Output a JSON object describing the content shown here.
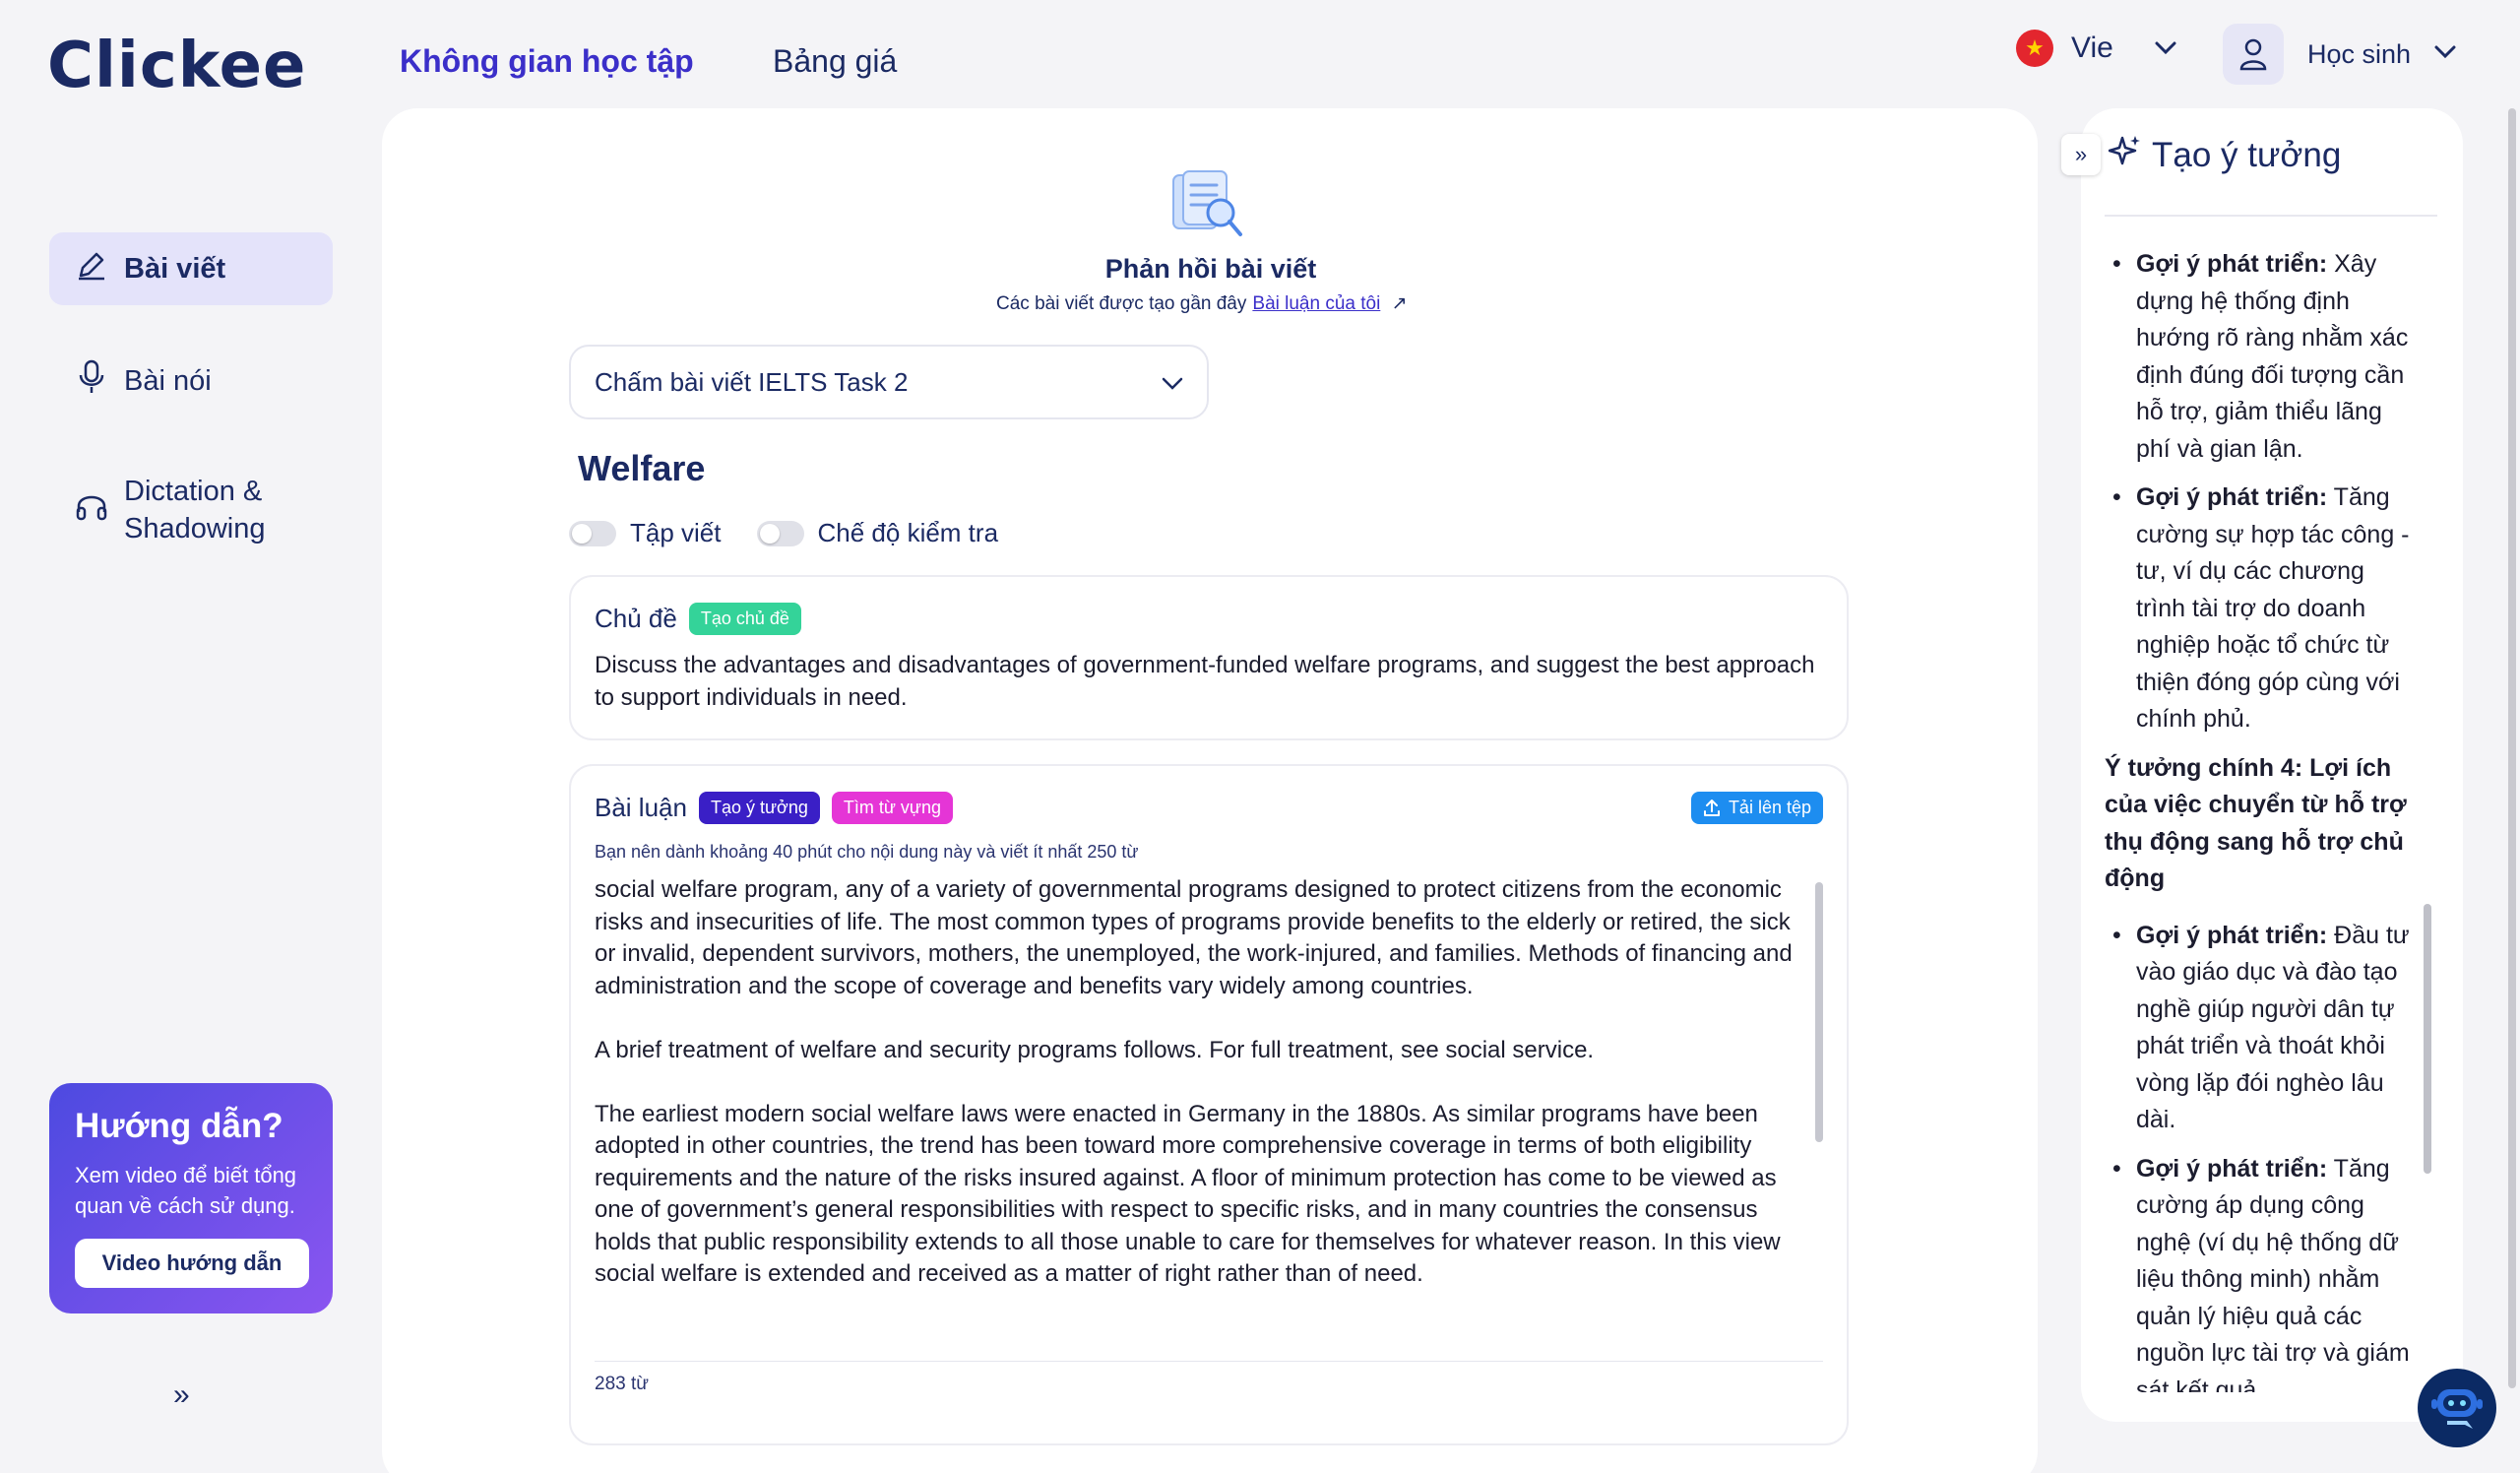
{
  "header": {
    "logo": "Clickee",
    "nav": {
      "learning_space": "Không gian học tập",
      "pricing": "Bảng giá"
    },
    "language": "Vie",
    "user_role": "Học sinh"
  },
  "sidebar": {
    "items": [
      {
        "label": "Bài viết",
        "icon": "pencil-icon"
      },
      {
        "label": "Bài nói",
        "icon": "microphone-icon"
      },
      {
        "label": "Dictation & Shadowing",
        "icon": "headphones-icon"
      }
    ],
    "guide": {
      "title": "Hướng dẫn?",
      "text": "Xem video để biết tổng quan về cách sử dụng.",
      "button": "Video hướng dẫn"
    },
    "expand": "»"
  },
  "main": {
    "feedback_title": "Phản hồi bài viết",
    "feedback_sub": "Các bài viết được tạo gần đây",
    "feedback_link": "Bài luận của tôi",
    "task_select": "Chấm bài viết IELTS Task 2",
    "topic_title": "Welfare",
    "toggle_practice": "Tập viết",
    "toggle_test": "Chế độ kiểm tra",
    "topic": {
      "label": "Chủ đề",
      "badge": "Tạo chủ đề",
      "text": "Discuss the advantages and disadvantages of government-funded welfare programs, and suggest the best approach to support individuals in need."
    },
    "essay": {
      "label": "Bài luận",
      "badge_ideas": "Tạo ý tưởng",
      "badge_vocab": "Tìm từ vựng",
      "upload": "Tải lên tệp",
      "hint": "Bạn nên dành khoảng 40 phút cho nội dung này và viết ít nhất 250 từ",
      "paragraphs": [
        "social welfare program, any of a variety of governmental programs designed to protect citizens from the economic risks and insecurities of life. The most common types of programs provide benefits to the elderly or retired, the sick or invalid, dependent survivors, mothers, the unemployed, the work-injured, and families. Methods of financing and administration and the scope of coverage and benefits vary widely among countries.",
        "A brief treatment of welfare and security programs follows. For full treatment, see social service.",
        "The earliest modern social welfare laws were enacted in Germany in the 1880s. As similar programs have been adopted in other countries, the trend has been toward more comprehensive coverage in terms of both eligibility requirements and the nature of the risks insured against. A floor of minimum protection has come to be viewed as one of government’s general responsibilities with respect to specific risks, and in many countries the consensus holds that public responsibility extends to all those unable to care for themselves for whatever reason. In this view social welfare is extended and received as a matter of right rather than of need."
      ],
      "word_count": "283 từ"
    }
  },
  "right_panel": {
    "title": "Tạo ý tưởng",
    "collapse": "»",
    "block1": [
      {
        "lead": "Gợi ý phát triển:",
        "text": " Xây dựng hệ thống định hướng rõ ràng nhằm xác định đúng đối tượng cần hỗ trợ, giảm thiểu lãng phí và gian lận."
      },
      {
        "lead": "Gợi ý phát triển:",
        "text": " Tăng cường sự hợp tác công - tư, ví dụ các chương trình tài trợ do doanh nghiệp hoặc tổ chức từ thiện đóng góp cùng với chính phủ."
      }
    ],
    "heading": "Ý tưởng chính 4: Lợi ích của việc chuyển từ hỗ trợ thụ động sang hỗ trợ chủ động",
    "block2": [
      {
        "lead": "Gợi ý phát triển:",
        "text": " Đầu tư vào giáo dục và đào tạo nghề giúp người dân tự phát triển và thoát khỏi vòng lặp đói nghèo lâu dài."
      },
      {
        "lead": "Gợi ý phát triển:",
        "text": " Tăng cường áp dụng công nghệ (ví dụ hệ thống dữ liệu thông minh) nhằm quản lý hiệu quả các nguồn lực tài trợ và giám sát kết quả."
      }
    ]
  },
  "colors": {
    "accent": "#3b2fc9",
    "green_badge": "#34d399",
    "pink_badge": "#e535d6",
    "blue_badge": "#1d8df0"
  }
}
